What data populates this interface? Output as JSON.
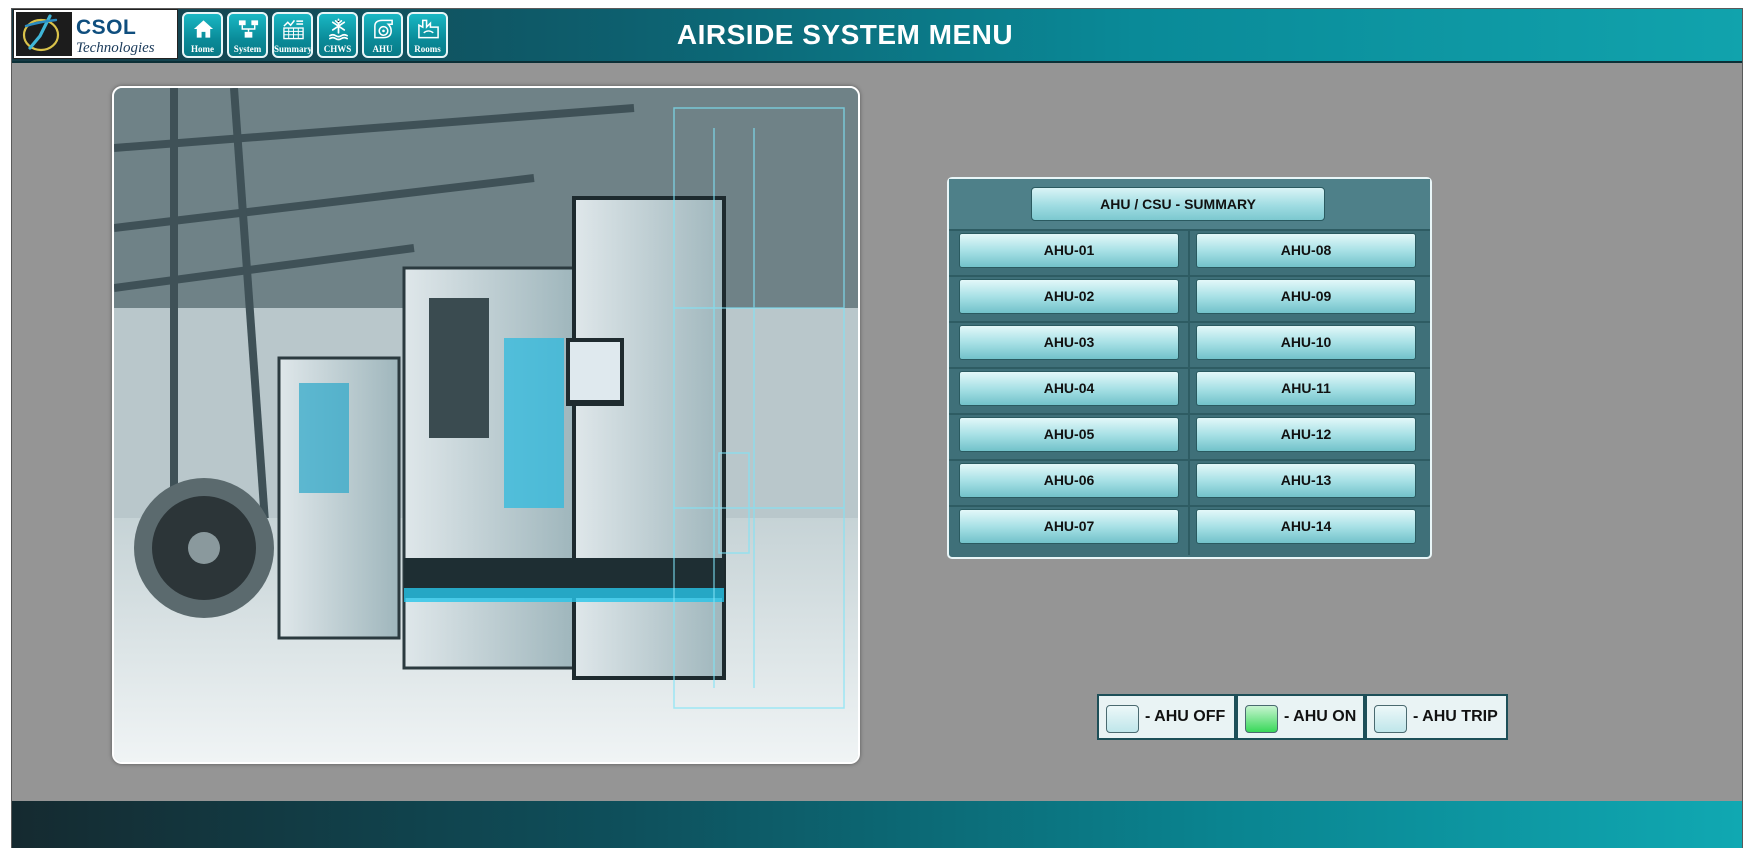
{
  "app": {
    "title": "AIRSIDE SYSTEM MENU",
    "logo": {
      "line1": "CSOL",
      "line2": "Technologies"
    }
  },
  "nav": [
    {
      "label": "Home",
      "icon": "home-icon"
    },
    {
      "label": "System",
      "icon": "system-diagram-icon"
    },
    {
      "label": "Summary",
      "icon": "summary-table-icon"
    },
    {
      "label": "CHWS",
      "icon": "snowflake-icon"
    },
    {
      "label": "AHU",
      "icon": "fan-icon"
    },
    {
      "label": "Rooms",
      "icon": "room-icon"
    }
  ],
  "panel": {
    "summary_label": "AHU / CSU - SUMMARY",
    "left": [
      "AHU-01",
      "AHU-02",
      "AHU-03",
      "AHU-04",
      "AHU-05",
      "AHU-06",
      "AHU-07"
    ],
    "right": [
      "AHU-08",
      "AHU-09",
      "AHU-10",
      "AHU-11",
      "AHU-12",
      "AHU-13",
      "AHU-14"
    ]
  },
  "legend": [
    {
      "label": "- AHU OFF",
      "color": "#bfe6ea"
    },
    {
      "label": "- AHU ON",
      "color": "#39d85a"
    },
    {
      "label": "- AHU TRIP",
      "color": "#bfe6ea"
    }
  ],
  "colors": {
    "header_accent": "#0a8a98",
    "panel_bg": "#3f7079",
    "page_bg": "#959595"
  }
}
